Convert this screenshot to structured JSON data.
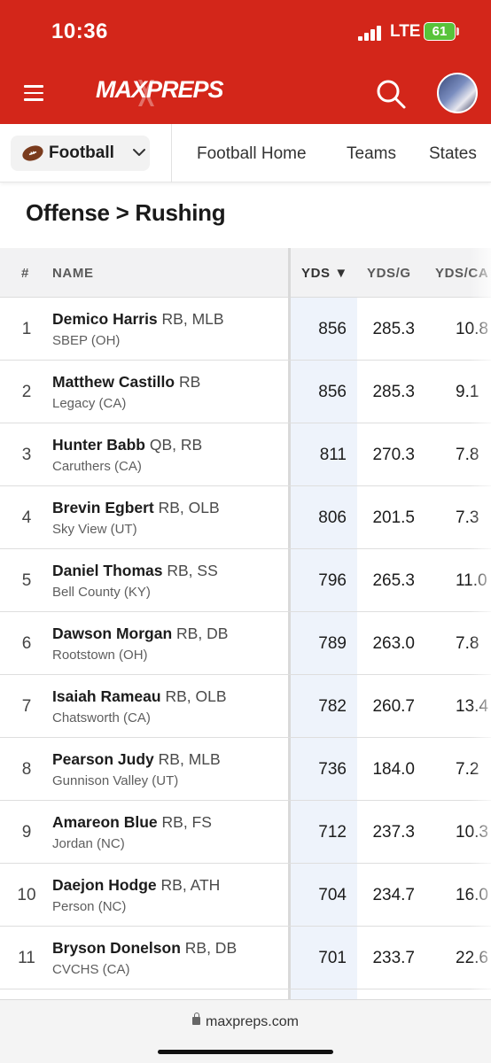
{
  "status_bar": {
    "time": "10:36",
    "network": "LTE",
    "battery": "61"
  },
  "header": {
    "logo_text": "MAXPREPS"
  },
  "subnav": {
    "sport": "Football",
    "links": [
      "Football Home",
      "Teams",
      "States"
    ]
  },
  "page_title": "Offense > Rushing",
  "table": {
    "columns": [
      "#",
      "NAME",
      "YDS ▼",
      "YDS/G",
      "YDS/CA"
    ],
    "rows": [
      {
        "rank": "1",
        "name": "Demico Harris",
        "pos": "RB, MLB",
        "school": "SBEP (OH)",
        "yds": "856",
        "ydsg": "285.3",
        "ydsca": "10.8"
      },
      {
        "rank": "2",
        "name": "Matthew Castillo",
        "pos": "RB",
        "school": "Legacy (CA)",
        "yds": "856",
        "ydsg": "285.3",
        "ydsca": "9.1"
      },
      {
        "rank": "3",
        "name": "Hunter Babb",
        "pos": "QB, RB",
        "school": "Caruthers (CA)",
        "yds": "811",
        "ydsg": "270.3",
        "ydsca": "7.8"
      },
      {
        "rank": "4",
        "name": "Brevin Egbert",
        "pos": "RB, OLB",
        "school": "Sky View (UT)",
        "yds": "806",
        "ydsg": "201.5",
        "ydsca": "7.3"
      },
      {
        "rank": "5",
        "name": "Daniel Thomas",
        "pos": "RB, SS",
        "school": "Bell County (KY)",
        "yds": "796",
        "ydsg": "265.3",
        "ydsca": "11.0"
      },
      {
        "rank": "6",
        "name": "Dawson Morgan",
        "pos": "RB, DB",
        "school": "Rootstown (OH)",
        "yds": "789",
        "ydsg": "263.0",
        "ydsca": "7.8"
      },
      {
        "rank": "7",
        "name": "Isaiah Rameau",
        "pos": "RB, OLB",
        "school": "Chatsworth (CA)",
        "yds": "782",
        "ydsg": "260.7",
        "ydsca": "13.4"
      },
      {
        "rank": "8",
        "name": "Pearson Judy",
        "pos": "RB, MLB",
        "school": "Gunnison Valley (UT)",
        "yds": "736",
        "ydsg": "184.0",
        "ydsca": "7.2"
      },
      {
        "rank": "9",
        "name": "Amareon Blue",
        "pos": "RB, FS",
        "school": "Jordan (NC)",
        "yds": "712",
        "ydsg": "237.3",
        "ydsca": "10.3"
      },
      {
        "rank": "10",
        "name": "Daejon Hodge",
        "pos": "RB, ATH",
        "school": "Person (NC)",
        "yds": "704",
        "ydsg": "234.7",
        "ydsca": "16.0"
      },
      {
        "rank": "11",
        "name": "Bryson Donelson",
        "pos": "RB, DB",
        "school": "CVCHS (CA)",
        "yds": "701",
        "ydsg": "233.7",
        "ydsca": "22.6"
      }
    ]
  },
  "browser": {
    "url": "maxpreps.com"
  },
  "colors": {
    "brand_red": "#d3261a",
    "battery_green": "#58c33a",
    "sorted_column": "#eef3fb"
  }
}
